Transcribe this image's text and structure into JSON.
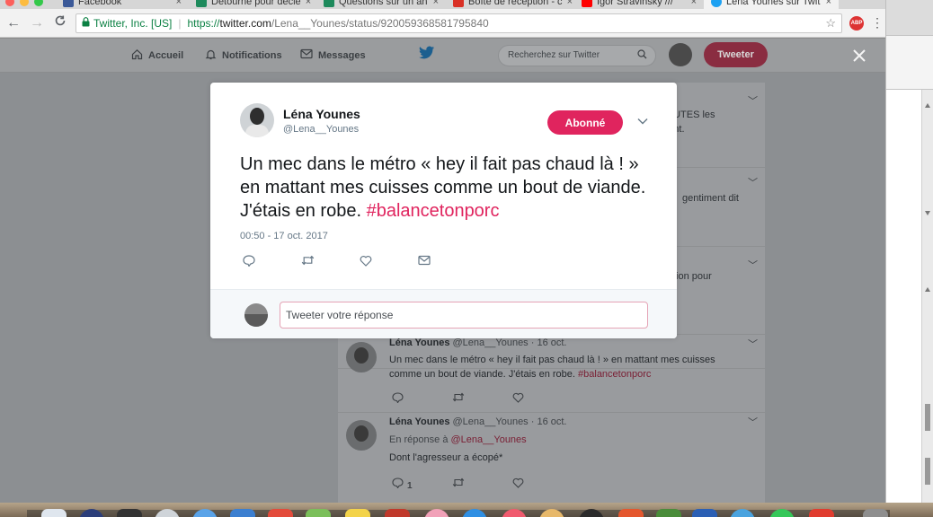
{
  "browser": {
    "tabs": [
      {
        "label": "Facebook",
        "favicon_color": "#3b5998"
      },
      {
        "label": "Détourné pour décle",
        "favicon_color": "#1e8a5c"
      },
      {
        "label": "Questions sur un an",
        "favicon_color": "#1e8a5c"
      },
      {
        "label": "Boîte de réception - c",
        "favicon_color": "#d93025"
      },
      {
        "label": "Igor Stravinsky ///",
        "favicon_color": "#ff0000"
      },
      {
        "label": "Léna Younes sur Twit",
        "favicon_color": "#1da1f2"
      }
    ],
    "tab_close": "×",
    "back": "←",
    "forward": "→",
    "reload": "C",
    "ev_name": "Twitter, Inc. [US]",
    "url_scheme": "https://",
    "url_host": "twitter.com",
    "url_path": "/Lena__Younes/status/920059368581795840",
    "bookmark_icon": "star-icon",
    "extension_label": "ABP",
    "menu_icon": "⋮"
  },
  "twitter_nav": {
    "home": "Accueil",
    "notifications": "Notifications",
    "messages": "Messages",
    "search_placeholder": "Recherchez sur Twitter",
    "tweet_button": "Tweeter"
  },
  "overlay": {
    "close": "×"
  },
  "timeline": {
    "snippet_1": "TOUTES les\nment.",
    "snippet_2": "gentiment dit",
    "snippet_3": "llation pour",
    "tweet_a": {
      "name": "Léna Younes",
      "meta": "@Lena__Younes · 16 oct.",
      "text": "Un mec dans le métro « hey il fait pas chaud là ! » en mattant mes cuisses comme un bout de viande. J'étais en robe.",
      "hashtag": "#balancetonporc"
    },
    "tweet_b": {
      "name": "Léna Younes",
      "meta": "@Lena__Younes · 16 oct.",
      "reply_prefix": "En réponse à",
      "reply_to": "@Lena__Younes",
      "text": "Dont l'agresseur a écopé*",
      "reply_count": "1"
    }
  },
  "modal_tweet": {
    "name": "Léna Younes",
    "handle": "@Lena__Younes",
    "follow_state": "Abonné",
    "text": "Un mec dans le métro « hey il fait pas chaud là ! » en mattant mes cuisses comme un bout de viande. J'étais en robe.",
    "hashtag": "#balancetonporc",
    "timestamp": "00:50 - 17 oct. 2017",
    "reply_placeholder": "Tweeter votre réponse"
  },
  "colors": {
    "twitter_pink": "#e0245e",
    "twitter_blue": "#1da1f2",
    "secure_green": "#0b8043"
  }
}
